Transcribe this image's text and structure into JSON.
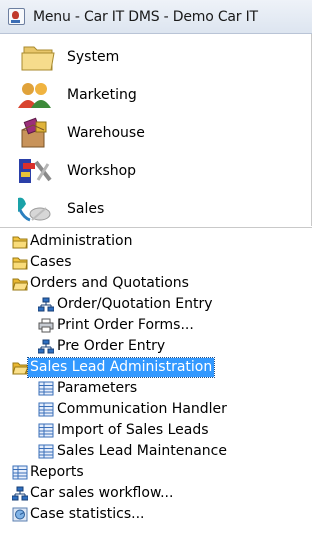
{
  "window": {
    "title": "Menu - Car IT DMS - Demo Car IT"
  },
  "modules": [
    {
      "label": "System",
      "icon": "folder-icon"
    },
    {
      "label": "Marketing",
      "icon": "people-icon"
    },
    {
      "label": "Warehouse",
      "icon": "boxes-icon"
    },
    {
      "label": "Workshop",
      "icon": "tools-icon"
    },
    {
      "label": "Sales",
      "icon": "car-keys-icon"
    }
  ],
  "tree": {
    "administration": "Administration",
    "cases": "Cases",
    "orders_quotations": "Orders and Quotations",
    "order_quotation_entry": "Order/Quotation Entry",
    "print_order_forms": "Print Order Forms...",
    "pre_order_entry": "Pre Order Entry",
    "sales_lead_admin": "Sales Lead Administration",
    "parameters": "Parameters",
    "communication_handler": "Communication Handler",
    "import_sales_leads": "Import of Sales Leads",
    "sales_lead_maintenance": "Sales Lead Maintenance",
    "reports": "Reports",
    "car_sales_workflow": "Car sales workflow...",
    "case_statistics": "Case statistics..."
  },
  "colors": {
    "selection": "#3399ff",
    "folder": "#f4c542"
  }
}
